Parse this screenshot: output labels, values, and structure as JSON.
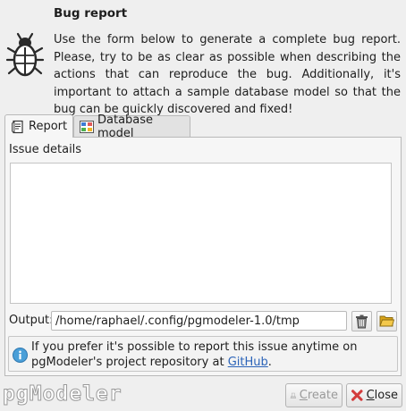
{
  "header": {
    "title": "Bug report",
    "description": "Use the form below to generate a complete bug report. Please, try to be as clear as possible when describing the actions that can reproduce the bug. Additionally, it's important to attach a sample database model so that the bug can be quickly discovered and fixed!",
    "icon": "bug-icon"
  },
  "tabs": [
    {
      "label": "Report",
      "icon": "report-document-icon",
      "active": true
    },
    {
      "label": "Database model",
      "icon": "database-model-icon",
      "active": false
    }
  ],
  "report": {
    "issue_label": "Issue details",
    "issue_value": "",
    "output_label": "Output:",
    "output_value": "/home/raphael/.config/pgmodeler-1.0/tmp"
  },
  "info": {
    "text_before": "If you prefer it's possible to report this issue anytime on pgModeler's project repository at ",
    "link_text": "GitHub",
    "text_after": "."
  },
  "footer": {
    "logo_text": "pgModeler",
    "create_label": "Create",
    "create_rest": "reate",
    "create_first": "C",
    "close_first": "C",
    "close_rest": "lose",
    "create_enabled": false
  },
  "colors": {
    "link": "#2b63b8",
    "close_icon": "#d33c3c",
    "info_icon": "#4a9fd8"
  }
}
